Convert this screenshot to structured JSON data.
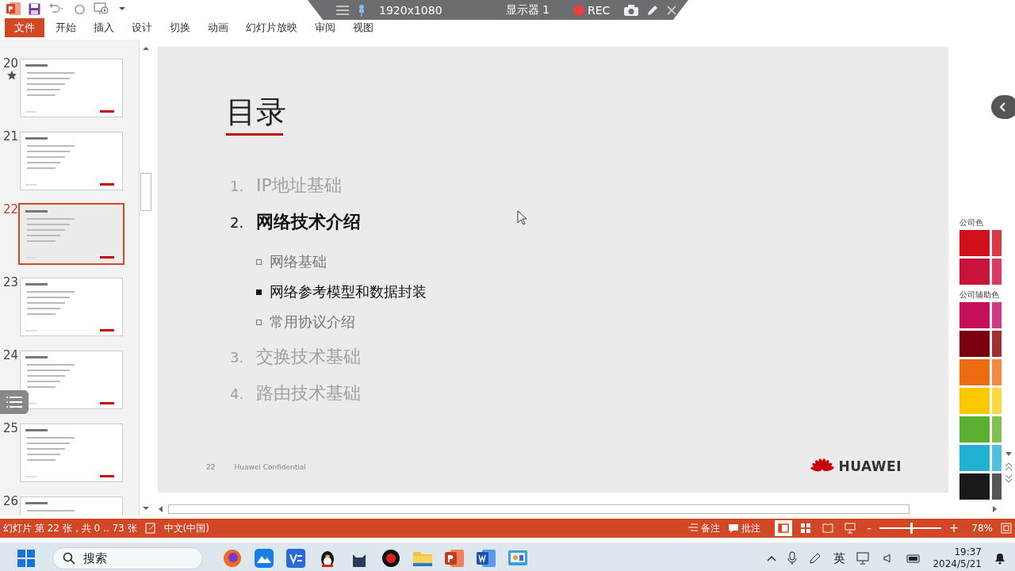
{
  "recorder": {
    "resolution": "1920x1080",
    "display": "显示器 1",
    "rec": "REC"
  },
  "ribbon_tabs": [
    {
      "label": "文件",
      "kind": "file"
    },
    {
      "label": "开始",
      "kind": "tab"
    },
    {
      "label": "插入",
      "kind": "tab"
    },
    {
      "label": "设计",
      "kind": "tab"
    },
    {
      "label": "切换",
      "kind": "tab"
    },
    {
      "label": "动画",
      "kind": "tab"
    },
    {
      "label": "幻灯片放映",
      "kind": "tab"
    },
    {
      "label": "审阅",
      "kind": "tab"
    },
    {
      "label": "视图",
      "kind": "tab"
    }
  ],
  "thumbnails": [
    {
      "number": "20",
      "starred": true,
      "selected": false
    },
    {
      "number": "21",
      "starred": false,
      "selected": false
    },
    {
      "number": "22",
      "starred": false,
      "selected": true
    },
    {
      "number": "23",
      "starred": false,
      "selected": false
    },
    {
      "number": "24",
      "starred": false,
      "selected": false
    },
    {
      "number": "25",
      "starred": false,
      "selected": false
    },
    {
      "number": "26",
      "starred": false,
      "selected": false
    }
  ],
  "slide": {
    "title": "目录",
    "items": [
      {
        "number": "1.",
        "text": "IP地址基础",
        "current": false
      },
      {
        "number": "2.",
        "text": "网络技术介绍",
        "current": true,
        "children": [
          {
            "text": "网络基础",
            "current": false
          },
          {
            "text": "网络参考模型和数据封装",
            "current": true
          },
          {
            "text": "常用协议介绍",
            "current": false
          }
        ]
      },
      {
        "number": "3.",
        "text": "交换技术基础",
        "current": false
      },
      {
        "number": "4.",
        "text": "路由技术基础",
        "current": false
      }
    ],
    "page": "22",
    "footer": "Huawei Confidential",
    "logo": "HUAWEI"
  },
  "palette": [
    {
      "label": "公司色",
      "swatches": [
        {
          "color": "#d0101b"
        },
        {
          "color": "#d83a45"
        },
        {
          "color": "#c8133b"
        },
        {
          "color": "#d83a60"
        }
      ]
    },
    {
      "label": "公司辅助色",
      "swatches": [
        {
          "color": "#c8105a"
        },
        {
          "color": "#d03a80"
        },
        {
          "color": "#7a0010"
        },
        {
          "color": "#a03030"
        },
        {
          "color": "#ec6c10"
        },
        {
          "color": "#f08a40"
        },
        {
          "color": "#fbc800"
        },
        {
          "color": "#fbd840"
        },
        {
          "color": "#5cb030"
        },
        {
          "color": "#80c050"
        },
        {
          "color": "#20b0d0"
        },
        {
          "color": "#50c0dc"
        },
        {
          "color": "#1a1818"
        },
        {
          "color": "#555555"
        }
      ]
    }
  ],
  "status_bar": {
    "slide_info": "幻灯片 第 22 张，共 0 .. 73 张",
    "language": "中文(中国)",
    "notes": "备注",
    "comments": "批注",
    "views": [
      {
        "kind": "normal",
        "selected": true
      },
      {
        "kind": "sorter",
        "selected": false
      },
      {
        "kind": "reading",
        "selected": false
      },
      {
        "kind": "slideshow",
        "selected": false
      }
    ],
    "zoom_minus": "-",
    "zoom_plus": "+",
    "zoom": {
      "level": 0.5
    },
    "zoom_text": "78%"
  },
  "taskbar": {
    "search": "搜索",
    "ime": "英",
    "time": "19:37",
    "date": "2024/5/21"
  }
}
